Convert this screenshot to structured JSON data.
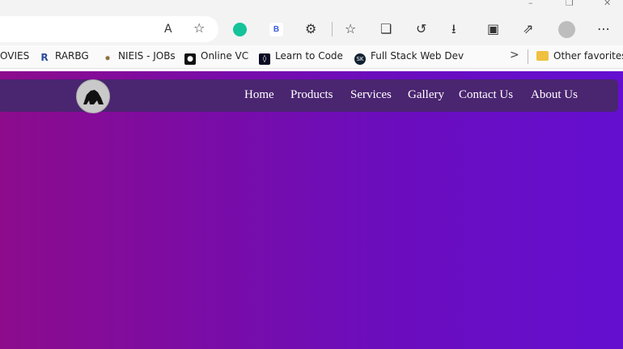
{
  "window": {
    "minimize": "–",
    "maximize": "❐",
    "close": "✕"
  },
  "toolbar_icons": [
    "read-aloud",
    "favorite-star",
    "grammarly",
    "bing-extension",
    "extensions",
    "favorites",
    "collections",
    "history",
    "downloads",
    "math-solver",
    "share",
    "profile",
    "more"
  ],
  "toolbar_labels": {
    "read_aloud": "A",
    "bing": "B",
    "more": "⋯"
  },
  "favorites": [
    {
      "label": "OVIES"
    },
    {
      "label": "RARBG",
      "icon": "R"
    },
    {
      "label": "NIEIS - JOBs"
    },
    {
      "label": "Online VC"
    },
    {
      "label": "Learn to Code"
    },
    {
      "label": "Full Stack Web Dev",
      "icon": "SK"
    }
  ],
  "favorites_more": ">",
  "other_favorites": "Other favorites",
  "nav": {
    "links": [
      "Home",
      "Products",
      "Services",
      "Gallery",
      "Contact Us",
      "About Us"
    ]
  },
  "colors": {
    "navbar": "#4a2570",
    "gradient_start": "#8c0c8c",
    "gradient_end": "#640ed0",
    "grammarly": "#15c39a"
  }
}
